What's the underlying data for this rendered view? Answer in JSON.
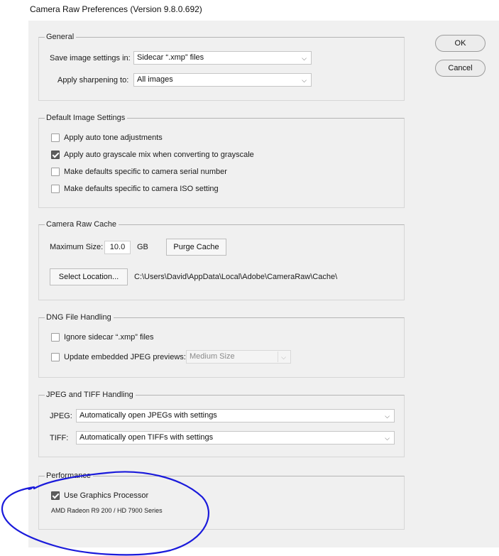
{
  "window": {
    "title": "Camera Raw Preferences  (Version 9.8.0.692)"
  },
  "buttons": {
    "ok": "OK",
    "cancel": "Cancel"
  },
  "general": {
    "legend": "General",
    "save_label": "Save image settings in:",
    "save_value": "Sidecar “.xmp” files",
    "sharpen_label": "Apply sharpening to:",
    "sharpen_value": "All images"
  },
  "defaults": {
    "legend": "Default Image Settings",
    "options": [
      {
        "label": "Apply auto tone adjustments",
        "checked": false
      },
      {
        "label": "Apply auto grayscale mix when converting to grayscale",
        "checked": true
      },
      {
        "label": "Make defaults specific to camera serial number",
        "checked": false
      },
      {
        "label": "Make defaults specific to camera ISO setting",
        "checked": false
      }
    ]
  },
  "cache": {
    "legend": "Camera Raw Cache",
    "max_label": "Maximum Size:",
    "max_value": "10.0",
    "unit": "GB",
    "purge": "Purge Cache",
    "select_location": "Select Location...",
    "path": "C:\\Users\\David\\AppData\\Local\\Adobe\\CameraRaw\\Cache\\"
  },
  "dng": {
    "legend": "DNG File Handling",
    "ignore_label": "Ignore sidecar “.xmp” files",
    "ignore_checked": false,
    "update_label": "Update embedded JPEG previews:",
    "update_checked": false,
    "preview_value": "Medium Size"
  },
  "jpeg_tiff": {
    "legend": "JPEG and TIFF Handling",
    "jpeg_label": "JPEG:",
    "jpeg_value": "Automatically open JPEGs with settings",
    "tiff_label": "TIFF:",
    "tiff_value": "Automatically open TIFFs with settings"
  },
  "performance": {
    "legend": "Performance",
    "gpu_label": "Use Graphics Processor",
    "gpu_checked": true,
    "gpu_name": "AMD Radeon R9 200 / HD 7900 Series"
  },
  "colors": {
    "panel": "#f0f0f0",
    "annotation": "#1a1adb",
    "checkbox_checked": "#5d5d5d"
  }
}
